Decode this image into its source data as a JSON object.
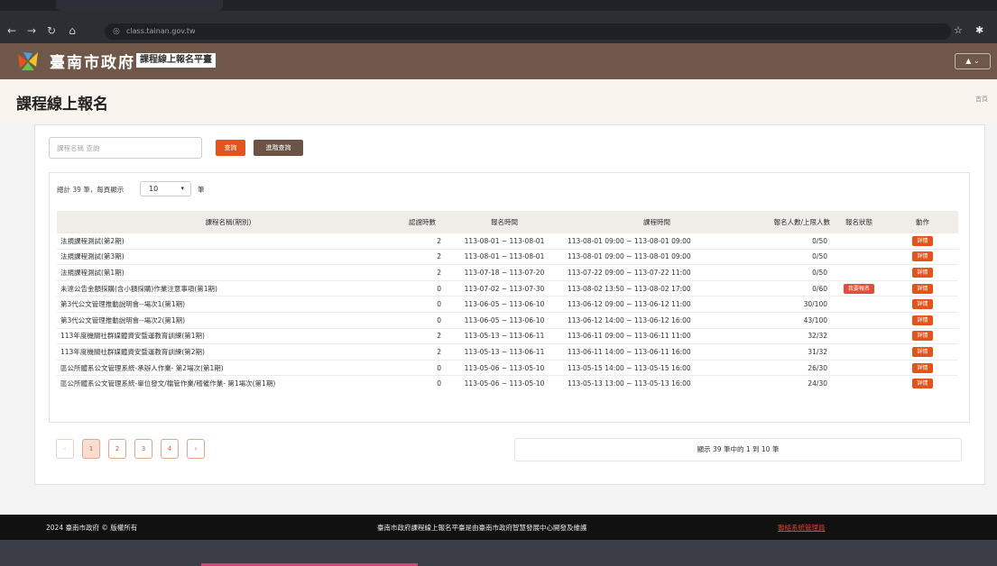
{
  "browser": {
    "url": "class.tainan.gov.tw",
    "icons": [
      "back-icon",
      "forward-icon",
      "reload-icon",
      "home-icon",
      "site-info-icon",
      "star-icon",
      "extensions-icon"
    ]
  },
  "header": {
    "title": "臺南市政府",
    "badge": "課程線上報名平臺",
    "user_menu": "▲ ⌄"
  },
  "page": {
    "title": "課程線上報名",
    "breadcrumb_home": "首頁"
  },
  "search": {
    "placeholder": "課程名稱 查詢",
    "search_label": "查詢",
    "advanced_label": "進階查詢"
  },
  "list": {
    "summary_prefix": "總計 39 筆，每頁顯示",
    "page_size": "10",
    "unit": "筆",
    "columns": [
      "課程名稱(期別)",
      "認證時數",
      "報名時間",
      "課程時間",
      "報名人數/上限人數",
      "報名狀態",
      "動作"
    ],
    "rows": [
      {
        "name": "法規課程測試(第2期)",
        "hours": "2",
        "reg": "113-08-01 ~ 113-08-01",
        "course": "113-08-01 09:00 ~ 113-08-01 09:00",
        "count": "0/50",
        "status": "",
        "action": "詳情"
      },
      {
        "name": "法規課程測試(第3期)",
        "hours": "2",
        "reg": "113-08-01 ~ 113-08-01",
        "course": "113-08-01 09:00 ~ 113-08-01 09:00",
        "count": "0/50",
        "status": "",
        "action": "詳情"
      },
      {
        "name": "法規課程測試(第1期)",
        "hours": "2",
        "reg": "113-07-18 ~ 113-07-20",
        "course": "113-07-22 09:00 ~ 113-07-22 11:00",
        "count": "0/50",
        "status": "",
        "action": "詳情"
      },
      {
        "name": "未達公告金額採購(含小額採購)作業注意事項(第1期)",
        "hours": "0",
        "reg": "113-07-02 ~ 113-07-30",
        "course": "113-08-02 13:50 ~ 113-08-02 17:00",
        "count": "0/60",
        "status": "我要報名",
        "action": "詳情"
      },
      {
        "name": "第3代公文管理推動說明會--場次1(第1期)",
        "hours": "0",
        "reg": "113-06-05 ~ 113-06-10",
        "course": "113-06-12 09:00 ~ 113-06-12 11:00",
        "count": "30/100",
        "status": "",
        "action": "詳情"
      },
      {
        "name": "第3代公文管理推動說明會--場次2(第1期)",
        "hours": "0",
        "reg": "113-06-05 ~ 113-06-10",
        "course": "113-06-12 14:00 ~ 113-06-12 16:00",
        "count": "43/100",
        "status": "",
        "action": "詳情"
      },
      {
        "name": "113年度機關社群媒體資安暨運教育訓練(第1期)",
        "hours": "2",
        "reg": "113-05-13 ~ 113-06-11",
        "course": "113-06-11 09:00 ~ 113-06-11 11:00",
        "count": "32/32",
        "status": "",
        "action": "詳情"
      },
      {
        "name": "113年度機關社群媒體資安暨運教育訓練(第2期)",
        "hours": "2",
        "reg": "113-05-13 ~ 113-06-11",
        "course": "113-06-11 14:00 ~ 113-06-11 16:00",
        "count": "31/32",
        "status": "",
        "action": "詳情"
      },
      {
        "name": "區公所體系公文管理系統-承辦人作業- 第2場次(第1期)",
        "hours": "0",
        "reg": "113-05-06 ~ 113-05-10",
        "course": "113-05-15 14:00 ~ 113-05-15 16:00",
        "count": "26/30",
        "status": "",
        "action": "詳情"
      },
      {
        "name": "區公所體系公文管理系統-單位發文/檔管作業/稽催作業- 第1場次(第1期)",
        "hours": "0",
        "reg": "113-05-06 ~ 113-05-10",
        "course": "113-05-13 13:00 ~ 113-05-13 16:00",
        "count": "24/30",
        "status": "",
        "action": "詳情"
      }
    ]
  },
  "pagination": {
    "prev": "‹",
    "pages": [
      "1",
      "2",
      "3",
      "4"
    ],
    "next": "›",
    "info": "顯示 39 筆中的 1 到 10 筆"
  },
  "footer": {
    "copyright": "2024 臺南市政府 © 版權所有",
    "note": "臺南市政府課程線上報名平臺是由臺南市政府智慧發展中心開發及維護",
    "admin_link": "聯絡系統管理員"
  },
  "colors": {
    "header_bg": "#6f5849",
    "accent": "#e2541c",
    "footer_bg": "#111111"
  }
}
